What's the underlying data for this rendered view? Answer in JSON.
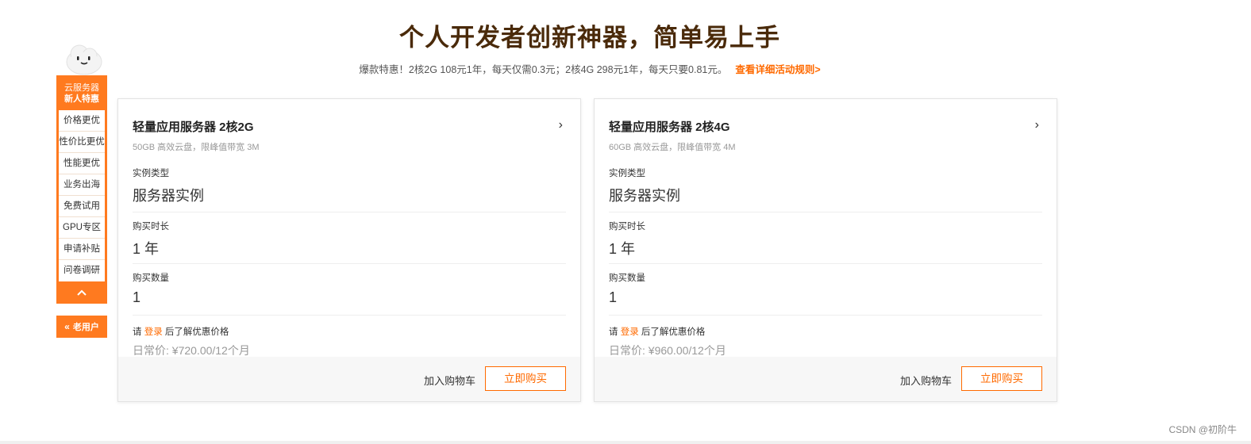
{
  "header": {
    "title": "个人开发者创新神器，简单易上手",
    "subtitle": "爆款特惠！2核2G 108元1年，每天仅需0.3元；2核4G 298元1年，每天只要0.81元。",
    "rules_link": "查看详细活动规则>"
  },
  "side_nav": {
    "head_line1": "云服务器",
    "head_line2": "新人特惠",
    "items": [
      "价格更优",
      "性价比更优",
      "性能更优",
      "业务出海",
      "免费试用",
      "GPU专区",
      "申请补贴",
      "问卷调研"
    ],
    "old_user": "老用户"
  },
  "cards": [
    {
      "title": "轻量应用服务器 2核2G",
      "desc": "50GB 高效云盘，限峰值带宽 3M",
      "fields": [
        {
          "label": "实例类型",
          "value": "服务器实例"
        },
        {
          "label": "购买时长",
          "value": "1 年"
        },
        {
          "label": "购买数量",
          "value": "1"
        }
      ],
      "login_prefix": "请 ",
      "login_link": "登录",
      "login_suffix": " 后了解优惠价格",
      "regular_price": "日常价: ¥720.00/12个月",
      "add_cart": "加入购物车",
      "buy_now": "立即购买"
    },
    {
      "title": "轻量应用服务器 2核4G",
      "desc": "60GB 高效云盘，限峰值带宽 4M",
      "fields": [
        {
          "label": "实例类型",
          "value": "服务器实例"
        },
        {
          "label": "购买时长",
          "value": "1 年"
        },
        {
          "label": "购买数量",
          "value": "1"
        }
      ],
      "login_prefix": "请 ",
      "login_link": "登录",
      "login_suffix": " 后了解优惠价格",
      "regular_price": "日常价: ¥960.00/12个月",
      "add_cart": "加入购物车",
      "buy_now": "立即购买"
    }
  ],
  "watermark": "CSDN @初阶牛",
  "colors": {
    "accent": "#ff6a00",
    "nav": "#ff7a1f",
    "title": "#4a2a0a"
  }
}
